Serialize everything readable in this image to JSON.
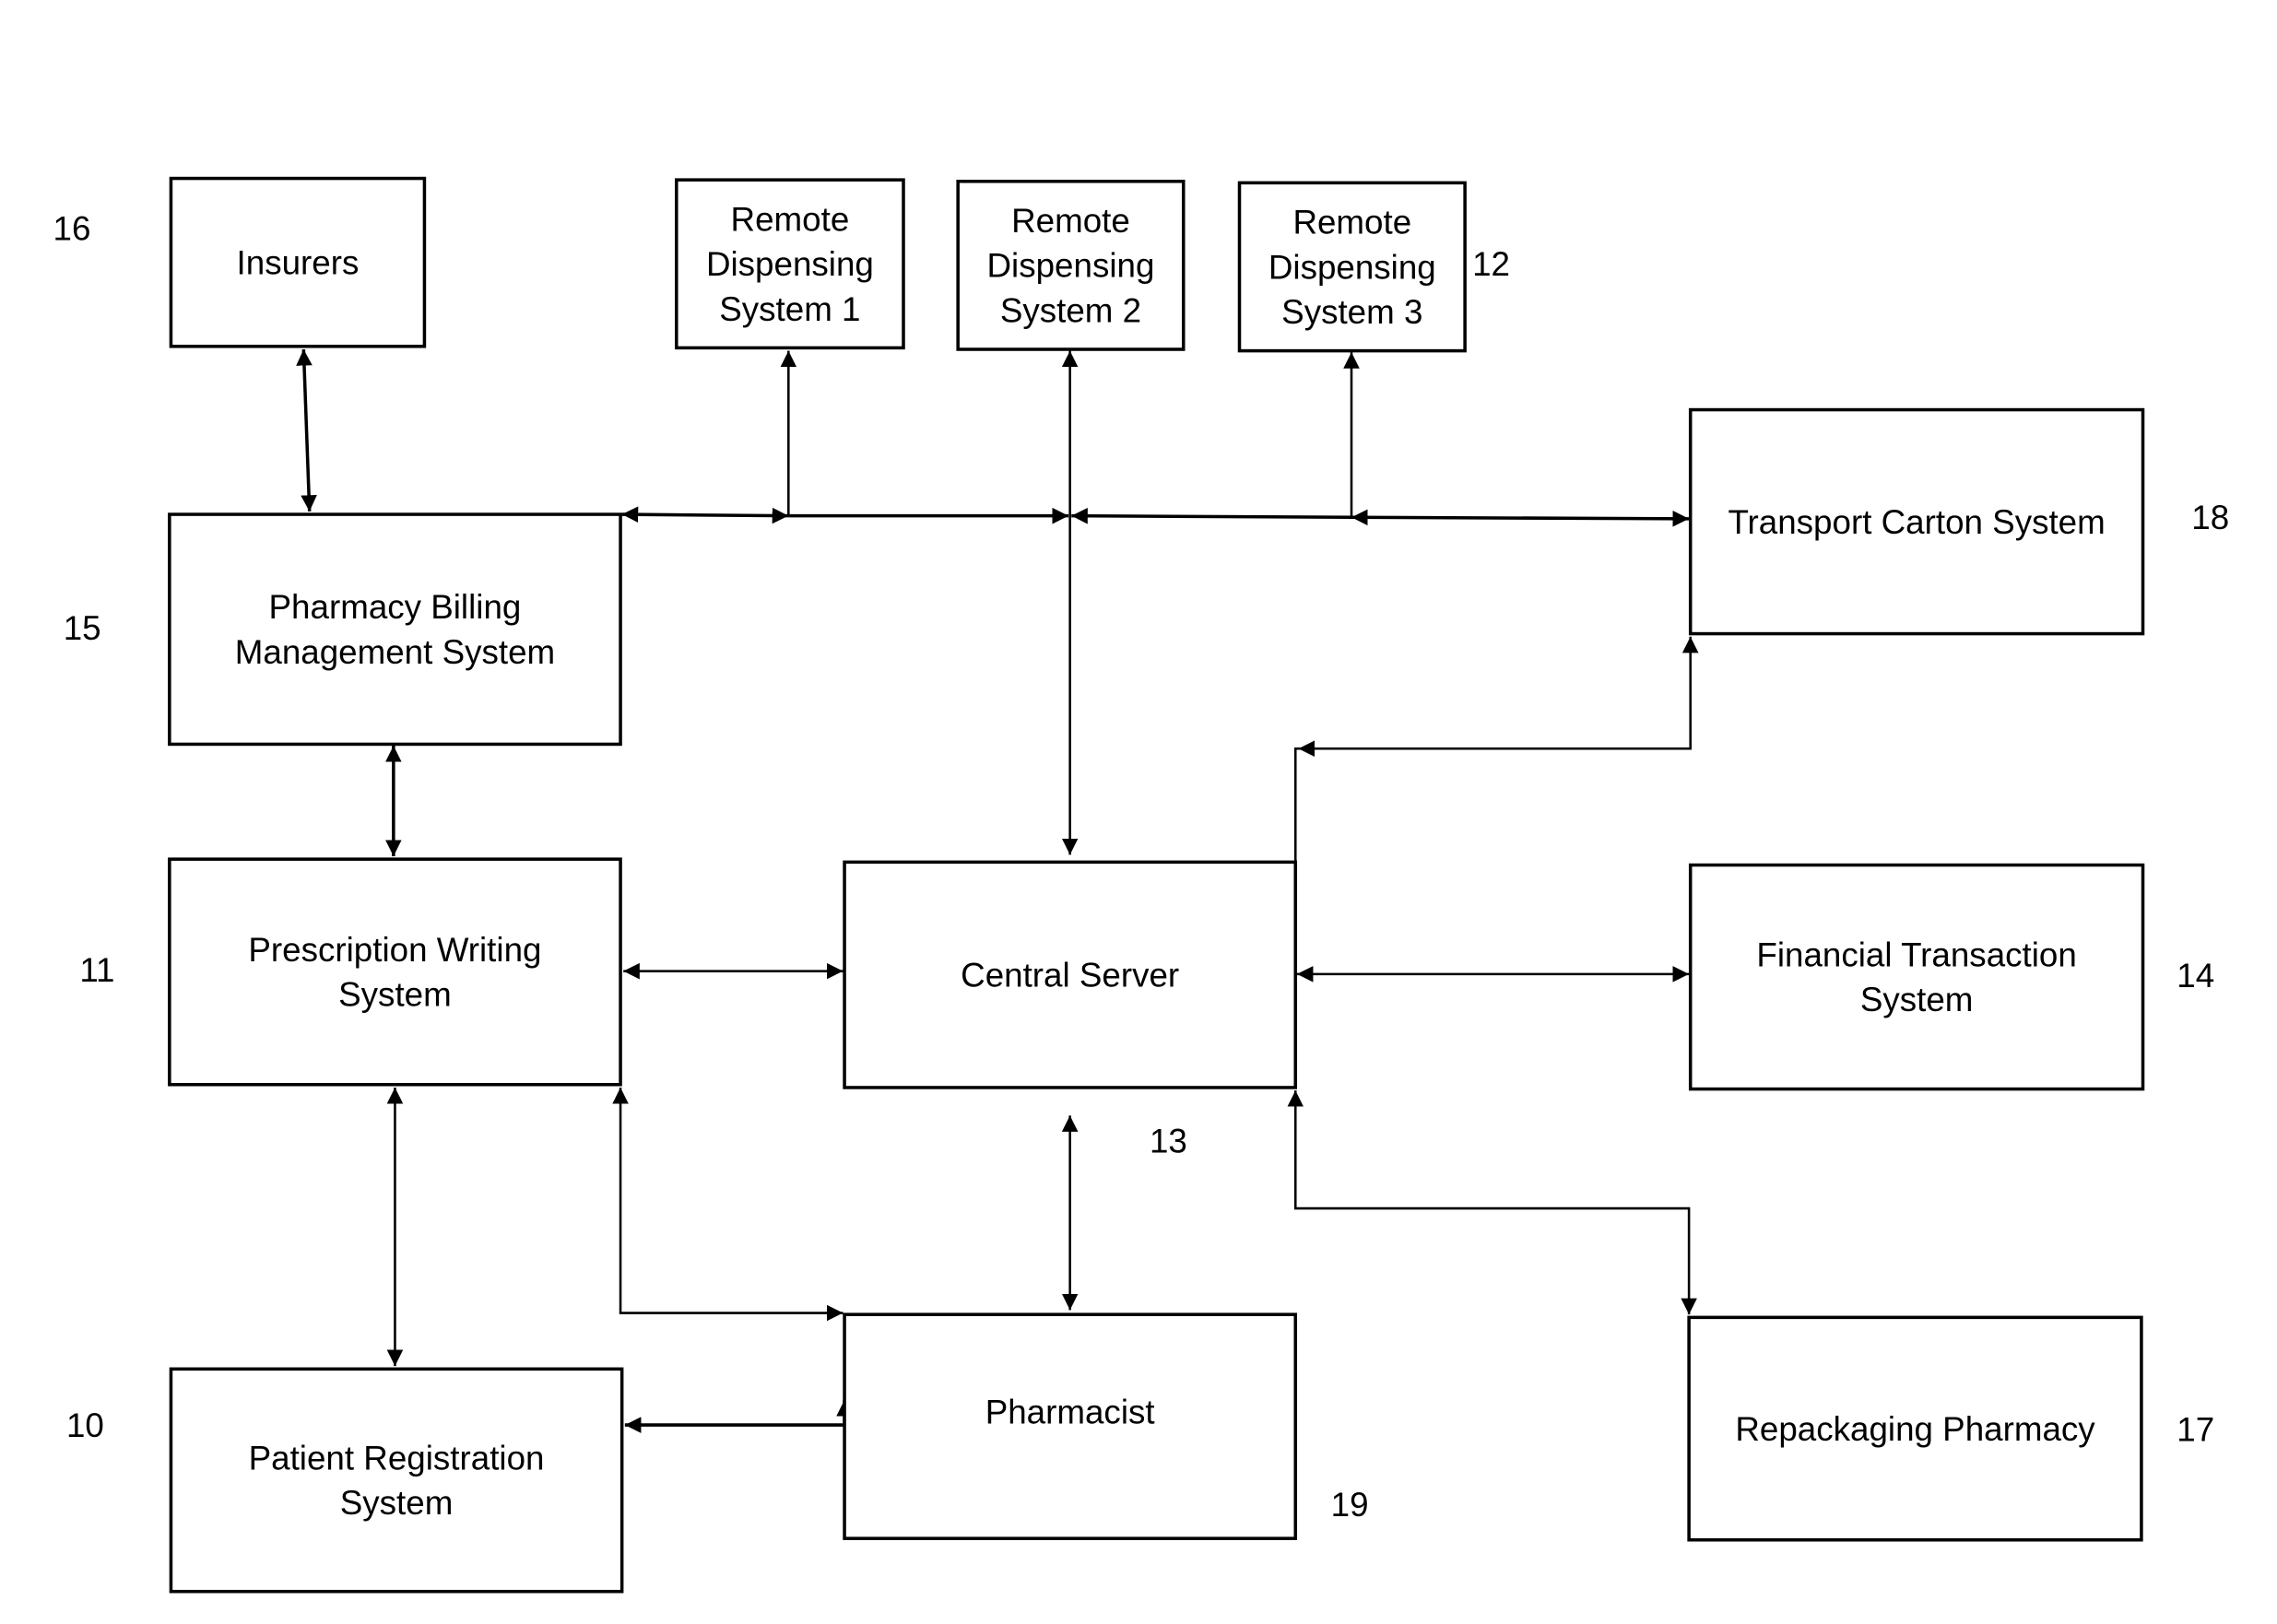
{
  "diagram": {
    "type": "block-diagram",
    "nodes": [
      {
        "id": "insurers",
        "lines": [
          "Insurers"
        ],
        "ref": "16"
      },
      {
        "id": "rds1",
        "lines": [
          "Remote",
          "Dispensing",
          "System 1"
        ],
        "ref": ""
      },
      {
        "id": "rds2",
        "lines": [
          "Remote",
          "Dispensing",
          "System 2"
        ],
        "ref": ""
      },
      {
        "id": "rds3",
        "lines": [
          "Remote",
          "Dispensing",
          "System 3"
        ],
        "ref": "12"
      },
      {
        "id": "transport",
        "lines": [
          "Transport Carton System"
        ],
        "ref": "18"
      },
      {
        "id": "billing",
        "lines": [
          "Pharmacy Billing",
          "Management System"
        ],
        "ref": "15"
      },
      {
        "id": "prescription",
        "lines": [
          "Prescription Writing",
          "System"
        ],
        "ref": "11"
      },
      {
        "id": "central",
        "lines": [
          "Central Server"
        ],
        "ref": "13"
      },
      {
        "id": "financial",
        "lines": [
          "Financial Transaction",
          "System"
        ],
        "ref": "14"
      },
      {
        "id": "patient",
        "lines": [
          "Patient Registration",
          "System"
        ],
        "ref": "10"
      },
      {
        "id": "pharmacist",
        "lines": [
          "Pharmacist"
        ],
        "ref": "19"
      },
      {
        "id": "repackaging",
        "lines": [
          "Repackaging Pharmacy"
        ],
        "ref": "17"
      }
    ],
    "edges": [
      {
        "from": "insurers",
        "to": "billing",
        "direction": "both"
      },
      {
        "from": "billing",
        "to": "bus",
        "direction": "both"
      },
      {
        "from": "rds1",
        "to": "bus",
        "direction": "both"
      },
      {
        "from": "rds2",
        "to": "bus",
        "direction": "both"
      },
      {
        "from": "rds3",
        "to": "bus",
        "direction": "both"
      },
      {
        "from": "bus",
        "to": "transport",
        "direction": "both"
      },
      {
        "from": "bus",
        "to": "central",
        "direction": "both"
      },
      {
        "from": "billing",
        "to": "prescription",
        "direction": "both"
      },
      {
        "from": "prescription",
        "to": "central",
        "direction": "both"
      },
      {
        "from": "central",
        "to": "financial",
        "direction": "both"
      },
      {
        "from": "central",
        "to": "transport",
        "direction": "both"
      },
      {
        "from": "central",
        "to": "repackaging",
        "direction": "both"
      },
      {
        "from": "prescription",
        "to": "patient",
        "direction": "both"
      },
      {
        "from": "prescription",
        "to": "pharmacist",
        "direction": "both"
      },
      {
        "from": "pharmacist",
        "to": "patient",
        "direction": "both"
      },
      {
        "from": "central",
        "to": "pharmacist",
        "direction": "both"
      }
    ]
  }
}
